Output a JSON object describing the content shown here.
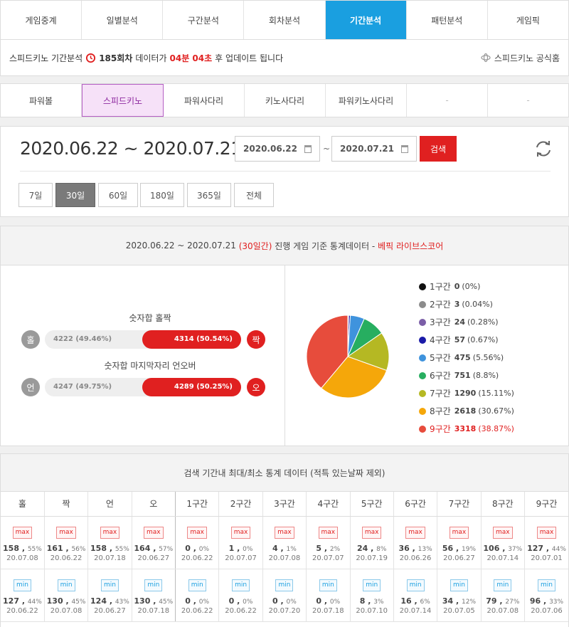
{
  "top_tabs": [
    "게임중계",
    "일별분석",
    "구간분석",
    "회차분석",
    "기간분석",
    "패턴분석",
    "게임픽"
  ],
  "top_tabs_active": 4,
  "info": {
    "prefix": "스피드키노 기간분석",
    "round": "185회차",
    "mid": "데이터가",
    "countdown": "04분 04초",
    "suffix": "후 업데이트 됩니다",
    "official": "스피드키노 공식홈"
  },
  "game_tabs": [
    "파워볼",
    "스피드키노",
    "파워사다리",
    "키노사다리",
    "파워키노사다리",
    "-",
    "-"
  ],
  "game_tabs_active": 1,
  "date": {
    "range": "2020.06.22 ~ 2020.07.21",
    "from": "2020.06.22",
    "tilde": "~",
    "to": "2020.07.21",
    "search": "검색"
  },
  "periods": [
    "7일",
    "30일",
    "60일",
    "180일",
    "365일",
    "전체"
  ],
  "periods_active": 1,
  "stats": {
    "head_range": "2020.06.22 ~ 2020.07.21",
    "head_days": "(30일간)",
    "head_mid": "진행 게임 기준 통계데이터 -",
    "head_brand": "베픽 라이브스코어",
    "oddeven_label": "숫자합 홀짝",
    "odd_char": "홀",
    "even_char": "짝",
    "odd_text": "4222 (49.46%)",
    "even_text": "4314 (50.54%)",
    "even_pct": 50.54,
    "underover_label": "숫자합 마지막자리 언오버",
    "under_char": "언",
    "over_char": "오",
    "under_text": "4247 (49.75%)",
    "over_text": "4289 (50.25%)",
    "over_pct": 50.25
  },
  "chart_data": {
    "type": "pie",
    "slices": [
      {
        "name": "1구간",
        "value": 0,
        "pct": "(0%)",
        "color": "#111111"
      },
      {
        "name": "2구간",
        "value": 3,
        "pct": "(0.04%)",
        "color": "#8c8c8c"
      },
      {
        "name": "3구간",
        "value": 24,
        "pct": "(0.28%)",
        "color": "#7b5ea7"
      },
      {
        "name": "4구간",
        "value": 57,
        "pct": "(0.67%)",
        "color": "#1a1aa8"
      },
      {
        "name": "5구간",
        "value": 475,
        "pct": "(5.56%)",
        "color": "#3f93dd"
      },
      {
        "name": "6구간",
        "value": 751,
        "pct": "(8.8%)",
        "color": "#27ae60"
      },
      {
        "name": "7구간",
        "value": 1290,
        "pct": "(15.11%)",
        "color": "#b5b823"
      },
      {
        "name": "8구간",
        "value": 2618,
        "pct": "(30.67%)",
        "color": "#f5a70a"
      },
      {
        "name": "9구간",
        "value": 3318,
        "pct": "(38.87%)",
        "color": "#e74c3c"
      }
    ],
    "highlight": 8
  },
  "minmax": {
    "title": "검색 기간내 최대/최소 통계 데이터 (적특 있는날짜 제외)",
    "max_tag": "max",
    "min_tag": "min",
    "columns": [
      "홀",
      "짝",
      "언",
      "오",
      "1구간",
      "2구간",
      "3구간",
      "4구간",
      "5구간",
      "6구간",
      "7구간",
      "8구간",
      "9구간"
    ],
    "max": [
      {
        "v": "158",
        "p": "55%",
        "d": "20.07.08"
      },
      {
        "v": "161",
        "p": "56%",
        "d": "20.06.22"
      },
      {
        "v": "158",
        "p": "55%",
        "d": "20.07.18"
      },
      {
        "v": "164",
        "p": "57%",
        "d": "20.06.27"
      },
      {
        "v": "0",
        "p": "0%",
        "d": "20.06.22"
      },
      {
        "v": "1",
        "p": "0%",
        "d": "20.07.07"
      },
      {
        "v": "4",
        "p": "1%",
        "d": "20.07.08"
      },
      {
        "v": "5",
        "p": "2%",
        "d": "20.07.07"
      },
      {
        "v": "24",
        "p": "8%",
        "d": "20.07.19"
      },
      {
        "v": "36",
        "p": "13%",
        "d": "20.06.26"
      },
      {
        "v": "56",
        "p": "19%",
        "d": "20.06.27"
      },
      {
        "v": "106",
        "p": "37%",
        "d": "20.07.14"
      },
      {
        "v": "127",
        "p": "44%",
        "d": "20.07.01"
      }
    ],
    "min": [
      {
        "v": "127",
        "p": "44%",
        "d": "20.06.22"
      },
      {
        "v": "130",
        "p": "45%",
        "d": "20.07.08"
      },
      {
        "v": "124",
        "p": "43%",
        "d": "20.06.27"
      },
      {
        "v": "130",
        "p": "45%",
        "d": "20.07.18"
      },
      {
        "v": "0",
        "p": "0%",
        "d": "20.06.22"
      },
      {
        "v": "0",
        "p": "0%",
        "d": "20.06.22"
      },
      {
        "v": "0",
        "p": "0%",
        "d": "20.07.20"
      },
      {
        "v": "0",
        "p": "0%",
        "d": "20.07.18"
      },
      {
        "v": "8",
        "p": "3%",
        "d": "20.07.10"
      },
      {
        "v": "16",
        "p": "6%",
        "d": "20.07.14"
      },
      {
        "v": "34",
        "p": "12%",
        "d": "20.07.05"
      },
      {
        "v": "79",
        "p": "27%",
        "d": "20.07.08"
      },
      {
        "v": "96",
        "p": "33%",
        "d": "20.07.06"
      }
    ]
  }
}
